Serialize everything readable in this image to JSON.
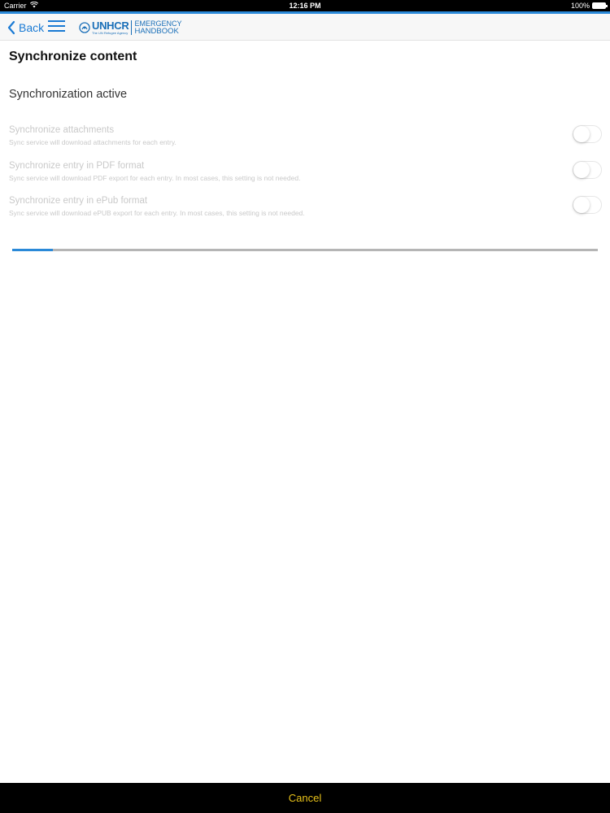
{
  "status_bar": {
    "carrier": "Carrier",
    "time": "12:16 PM",
    "battery": "100%"
  },
  "nav": {
    "back_label": "Back",
    "logo": {
      "brand": "UNHCR",
      "brand_sub": "The UN Refugee Agency",
      "line1": "EMERGENCY",
      "line2": "HANDBOOK"
    }
  },
  "page": {
    "title": "Synchronize content",
    "section_title": "Synchronization active"
  },
  "settings": [
    {
      "label": "Synchronize attachments",
      "description": "Sync service will download attachments for each entry.",
      "enabled": false
    },
    {
      "label": "Synchronize entry in PDF format",
      "description": "Sync service will download PDF export for each entry. In most cases, this setting is not needed.",
      "enabled": false
    },
    {
      "label": "Synchronize entry in ePub format",
      "description": "Sync service will download ePUB export for each entry. In most cases, this setting is not needed.",
      "enabled": false
    }
  ],
  "progress": {
    "fraction": 0.07
  },
  "bottom": {
    "cancel_label": "Cancel"
  },
  "colors": {
    "accent": "#2a89d8",
    "link": "#1a7ad4",
    "cancel": "#e8c21a",
    "disabled_text": "#c9c9c9"
  }
}
